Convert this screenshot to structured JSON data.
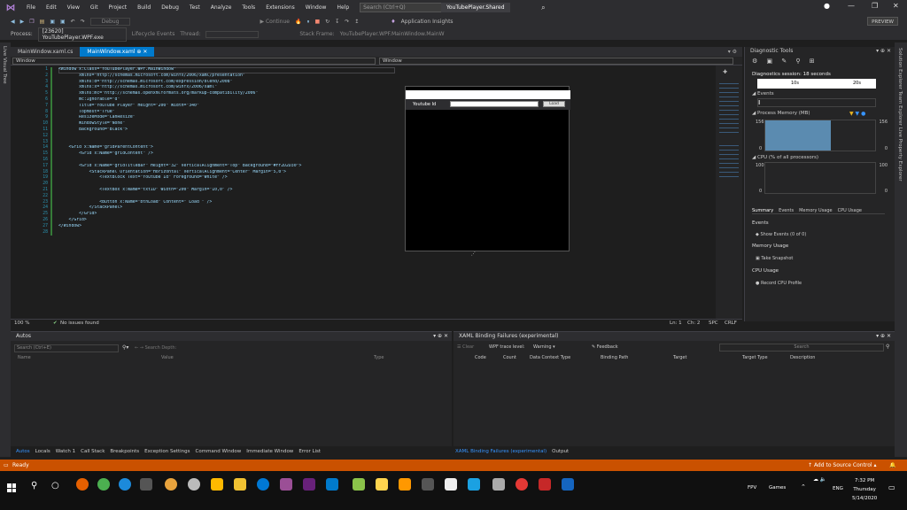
{
  "menu": {
    "items": [
      "File",
      "Edit",
      "View",
      "Git",
      "Project",
      "Build",
      "Debug",
      "Test",
      "Analyze",
      "Tools",
      "Extensions",
      "Window",
      "Help"
    ],
    "search_placeholder": "Search (Ctrl+Q)",
    "solution_name": "YouTubePlayer.Shared",
    "preview_label": "PREVIEW"
  },
  "toolbar": {
    "process_label": "Process:",
    "process_value": "[23620] YouTubePlayer.WPF.exe",
    "continue_label": "Continue",
    "app_insights_label": "Application Insights",
    "lifecycle_label": "Lifecycle Events",
    "thread_label": "Thread:",
    "stack_frame_label": "Stack Frame:",
    "stack_frame_value": "YouTubePlayer.WPF.MainWindow.MainW",
    "debug_label": "Debug"
  },
  "left_strip": {
    "label": "Live Visual Tree"
  },
  "right_strip": {
    "label": "Solution Explorer    Team Explorer    Live Property Explorer"
  },
  "editor_tabs": [
    {
      "label": "MainWindow.xaml.cs",
      "active": false
    },
    {
      "label": "MainWindow.xaml",
      "active": true
    }
  ],
  "xaml_header": {
    "left_dropdown": "Window",
    "right_dropdown": "Window"
  },
  "code_lines": [
    "<Window x:Class=\"YouTubePlayer.WPF.MainWindow\"",
    "        xmlns=\"http://schemas.microsoft.com/winfx/2006/xaml/presentation\"",
    "        xmlns:d=\"http://schemas.microsoft.com/expression/blend/2008\"",
    "        xmlns:x=\"http://schemas.microsoft.com/winfx/2006/xaml\"",
    "        xmlns:mc=\"http://schemas.openxmlformats.org/markup-compatibility/2006\"",
    "        mc:Ignorable=\"d\"",
    "        Title=\"YouTube Player\" Height=\"200\" Width=\"340\"",
    "        Topmost=\"True\"",
    "        ResizeMode=\"CanResize\"",
    "        WindowStyle=\"None\"",
    "        Background=\"Black\">",
    "",
    "",
    "    <Grid x:Name=\"gridParentContent\">",
    "        <Grid x:Name=\"gridContent\" />",
    "",
    "        <Grid x:Name=\"gridTitleBar\" Height=\"32\" VerticalAlignment=\"Top\" Background=\"#FF2D2D30\">",
    "            <StackPanel Orientation=\"Horizontal\" VerticalAlignment=\"Center\" Margin=\"5,0\">",
    "                <TextBlock Text=\"Youtube Id\" Foreground=\"White\" />",
    "",
    "                <TextBox x:Name=\"txtID\" Width=\"200\" Margin=\"10,0\" />",
    "",
    "                <Button x:Name=\"btnLoad\" Content=\" Load \" />",
    "            </StackPanel>",
    "        </Grid>",
    "    </Grid>",
    "</Window>",
    ""
  ],
  "line_numbers": [
    "1",
    "2",
    "3",
    "4",
    "5",
    "6",
    "7",
    "8",
    "9",
    "10",
    "11",
    "12",
    "13",
    "14",
    "15",
    "16",
    "17",
    "18",
    "19",
    "20",
    "21",
    "22",
    "23",
    "24",
    "25",
    "26",
    "27",
    "28"
  ],
  "designer": {
    "label": "Youtube Id",
    "button": "Load"
  },
  "editor_status": {
    "zoom": "100 %",
    "issues": "No issues found",
    "line": "Ln: 1",
    "col": "Ch: 2",
    "spc": "SPC",
    "crlf": "CRLF"
  },
  "diagnostics": {
    "title": "Diagnostic Tools",
    "session": "Diagnostics session: 18 seconds",
    "timeline_a": "10s",
    "timeline_b": "20s",
    "events_label": "Events",
    "memory_label": "Process Memory (MB)",
    "memory_max": "156",
    "memory_min": "0",
    "cpu_label": "CPU (% of all processors)",
    "cpu_max": "100",
    "cpu_min": "0",
    "tabs": [
      "Summary",
      "Events",
      "Memory Usage",
      "CPU Usage"
    ],
    "events_heading": "Events",
    "show_events": "Show Events (0 of 0)",
    "memory_heading": "Memory Usage",
    "take_snapshot": "Take Snapshot",
    "cpu_heading": "CPU Usage",
    "record_cpu": "Record CPU Profile",
    "memory_fraction": 0.6
  },
  "autos": {
    "title": "Autos",
    "search_placeholder": "Search (Ctrl+E)",
    "search_depth": "Search Depth:",
    "columns": [
      "Name",
      "Value",
      "Type"
    ]
  },
  "binding": {
    "title": "XAML Binding Failures (experimental)",
    "clear": "Clear",
    "trace_level_label": "WPF trace level:",
    "trace_level_value": "Warning",
    "feedback": "Feedback",
    "search_placeholder": "Search",
    "columns": [
      "Code",
      "Count",
      "Data Context Type",
      "Binding Path",
      "Target",
      "Target Type",
      "Description"
    ]
  },
  "bottom_tabs_left": [
    "Autos",
    "Locals",
    "Watch 1",
    "Call Stack",
    "Breakpoints",
    "Exception Settings",
    "Command Window",
    "Immediate Window",
    "Error List"
  ],
  "bottom_tabs_right": [
    "XAML Binding Failures (experimental)",
    "Output"
  ],
  "status": {
    "ready": "Ready",
    "add_source": "Add to Source Control"
  },
  "taskbar": {
    "fpv": "FPV",
    "games": "Games",
    "lang": "ENG",
    "time": "7:32 PM",
    "day": "Thursday",
    "date": "5/14/2020"
  },
  "colors": {
    "accent": "#007acc",
    "status": "#ca5100",
    "memory_fill": "#5b8bb0"
  }
}
